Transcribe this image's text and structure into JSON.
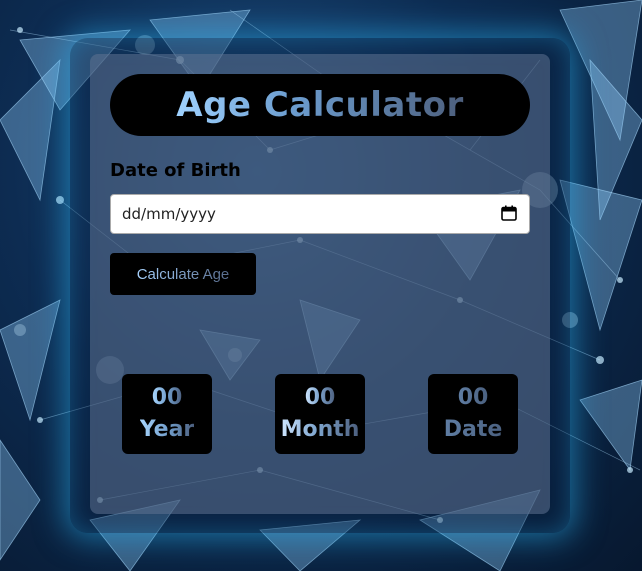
{
  "app": {
    "title": "Age Calculator"
  },
  "form": {
    "dob_label": "Date of Birth",
    "date_placeholder": "dd/mm/yyyy",
    "calculate_label": "Calculate Age"
  },
  "results": [
    {
      "value": "00",
      "label": "Year"
    },
    {
      "value": "00",
      "label": "Month"
    },
    {
      "value": "00",
      "label": "Date"
    }
  ],
  "colors": {
    "card_bg": "#5f7391",
    "accent_glow": "#28aae6",
    "text_gradient_start": "#9fd2ff",
    "text_gradient_end": "#4d5f7d"
  },
  "icons": {
    "calendar": "calendar-icon"
  }
}
